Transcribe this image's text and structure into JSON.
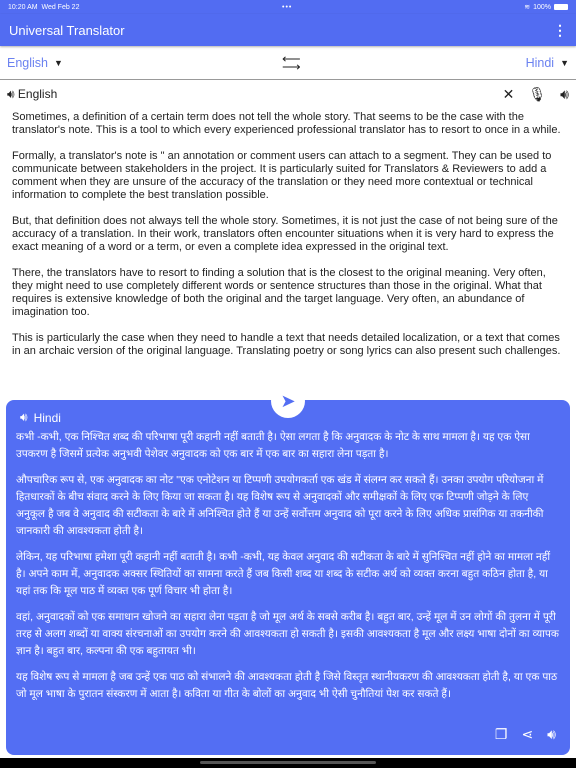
{
  "status": {
    "time": "10:20 AM",
    "date": "Wed Feb 22",
    "battery": "100%"
  },
  "appbar": {
    "title": "Universal Translator"
  },
  "languages": {
    "source": "English",
    "target": "Hindi"
  },
  "source": {
    "label": "English",
    "paragraphs": [
      "Sometimes, a definition of a certain term does not tell the whole story. That seems to be the case with the translator's note. This is a tool to which every experienced professional translator has to resort to once in a while.",
      "Formally, a translator's note is \" an annotation or comment users can attach to a segment. They can be used to communicate between stakeholders in the project. It is particularly suited for Translators & Reviewers to add a comment when they are unsure of the accuracy of the translation or they need more contextual or technical information to complete the best translation possible.",
      "But, that definition does not always tell the whole story. Sometimes, it is not just the case of not being sure of the accuracy of a translation. In their work, translators often encounter situations when it is very hard to express the exact meaning of a word or a term, or even a complete idea expressed in the original text.",
      "There, the translators have to resort to finding a solution that is the closest to the original meaning. Very often, they might need to use completely different words or sentence structures than those in the original. What that requires is extensive knowledge of both the original and the target language. Very often, an abundance of imagination too.",
      "This is particularly the case when they need to handle a text that needs detailed localization, or a text that comes in an archaic version of the original language. Translating poetry or song lyrics can also present such challenges."
    ]
  },
  "target": {
    "label": "Hindi",
    "paragraphs": [
      "कभी -कभी, एक निश्चित शब्द की परिभाषा पूरी कहानी नहीं बताती है। ऐसा लगता है कि अनुवादक के नोट के साथ मामला है। यह एक ऐसा उपकरण है जिसमें प्रत्येक अनुभवी पेशेवर अनुवादक को एक बार में एक बार का सहारा लेना पड़ता है।",
      "औपचारिक रूप से, एक अनुवादक का नोट \"एक एनोटेशन या टिप्पणी उपयोगकर्ता एक खंड में संलग्न कर सकते हैं। उनका उपयोग परियोजना में हितधारकों के बीच संवाद करने के लिए किया जा सकता है। यह विशेष रूप से अनुवादकों और समीक्षकों के लिए एक टिप्पणी जोड़ने के लिए अनुकूल है जब वे अनुवाद की सटीकता के बारे में अनिश्चित होते हैं या उन्हें सर्वोत्तम अनुवाद को पूरा करने के लिए अधिक प्रासंगिक या तकनीकी जानकारी की आवश्यकता होती है।",
      "लेकिन, यह परिभाषा हमेशा पूरी कहानी नहीं बताती है। कभी -कभी, यह केवल अनुवाद की सटीकता के बारे में सुनिश्चित नहीं होने का मामला नहीं है। अपने काम में, अनुवादक अक्सर स्थितियों का सामना करते हैं जब किसी शब्द या शब्द के सटीक अर्थ को व्यक्त करना बहुत कठिन होता है, या यहां तक कि मूल पाठ में व्यक्त एक पूर्ण विचार भी होता है।",
      "वहां, अनुवादकों को एक समाधान खोजने का सहारा लेना पड़ता है जो मूल अर्थ के सबसे करीब है। बहुत बार, उन्हें मूल में उन लोगों की तुलना में पूरी तरह से अलग शब्दों या वाक्य संरचनाओं का उपयोग करने की आवश्यकता हो सकती है। इसकी आवश्यकता है मूल और लक्ष्य भाषा दोनों का व्यापक ज्ञान है। बहुत बार, कल्पना की एक बहुतायत भी।",
      "यह विशेष रूप से मामला है जब उन्हें एक पाठ को संभालने की आवश्यकता होती है जिसे विस्तृत स्थानीयकरण की आवश्यकता होती है, या एक पाठ जो मूल भाषा के पुरातन संस्करण में आता है। कविता या गीत के बोलों का अनुवाद भी ऐसी चुनौतियां पेश कर सकते हैं।"
    ]
  },
  "colors": {
    "primary": "#526cf2",
    "language_text": "#6b82f0"
  }
}
